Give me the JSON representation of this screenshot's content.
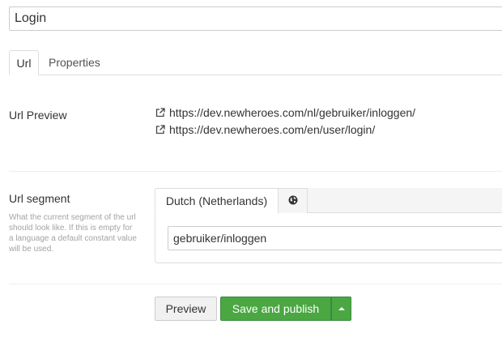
{
  "title_field": {
    "value": "Login"
  },
  "tabs": [
    {
      "label": "Url"
    },
    {
      "label": "Properties"
    }
  ],
  "url_preview": {
    "label": "Url Preview",
    "links": [
      {
        "icon": "external-link-icon",
        "text": "https://dev.newheroes.com/nl/gebruiker/inloggen/"
      },
      {
        "icon": "external-link-icon",
        "text": "https://dev.newheroes.com/en/user/login/"
      }
    ]
  },
  "url_segment": {
    "label": "Url segment",
    "help": "What the current segment of the url should look like. If this is empty for a language a default constant value will be used.",
    "language_tabs": [
      {
        "label": "Dutch (Netherlands)"
      },
      {
        "icon": "globe-icon"
      }
    ],
    "value": "gebruiker/inloggen"
  },
  "actions": {
    "preview_label": "Preview",
    "save_label": "Save and publish",
    "more_icon": "caret-up-icon"
  },
  "colors": {
    "primary": "#4aa742",
    "border": "#dddddd",
    "help_text": "#a3a3a3"
  }
}
